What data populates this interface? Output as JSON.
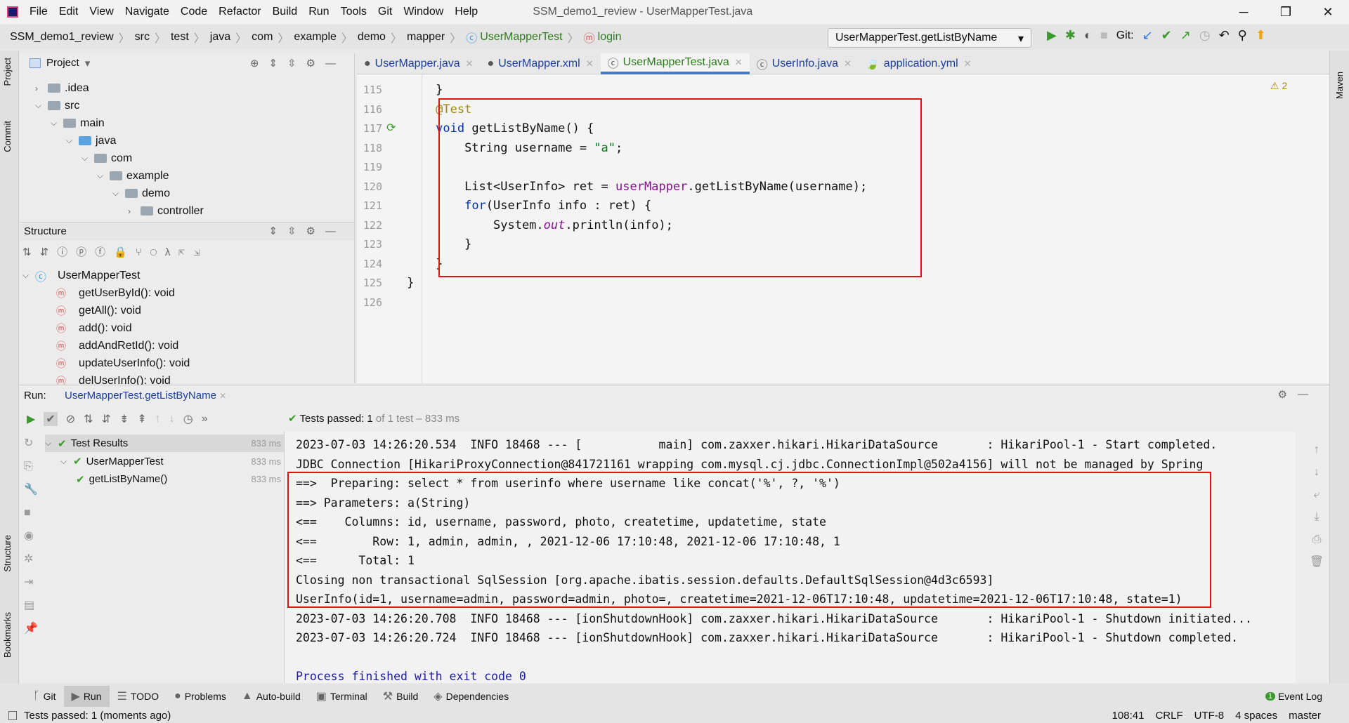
{
  "window": {
    "title": "SSM_demo1_review - UserMapperTest.java",
    "menu": [
      "File",
      "Edit",
      "View",
      "Navigate",
      "Code",
      "Refactor",
      "Build",
      "Run",
      "Tools",
      "Git",
      "Window",
      "Help"
    ],
    "controls": [
      "─",
      "❐",
      "✕"
    ]
  },
  "navbar": {
    "crumbs": [
      "SSM_demo1_review",
      "src",
      "test",
      "java",
      "com",
      "example",
      "demo",
      "mapper",
      "UserMapperTest",
      "login"
    ],
    "run_config": "UserMapperTest.getListByName",
    "git_label": "Git:"
  },
  "project": {
    "title": "Project",
    "tree": [
      {
        "label": ".idea",
        "depth": 1,
        "open": false
      },
      {
        "label": "src",
        "depth": 1,
        "open": true
      },
      {
        "label": "main",
        "depth": 2,
        "open": true
      },
      {
        "label": "java",
        "depth": 3,
        "open": true
      },
      {
        "label": "com",
        "depth": 4,
        "open": true
      },
      {
        "label": "example",
        "depth": 5,
        "open": true
      },
      {
        "label": "demo",
        "depth": 6,
        "open": true
      },
      {
        "label": "controller",
        "depth": 7,
        "open": false
      }
    ]
  },
  "structure": {
    "title": "Structure",
    "root": "UserMapperTest",
    "members": [
      "getUserById(): void",
      "getAll(): void",
      "add(): void",
      "addAndRetId(): void",
      "updateUserInfo(): void",
      "delUserInfo(): void"
    ]
  },
  "side_labels": {
    "left": [
      "Project",
      "Commit",
      "Structure",
      "Bookmarks"
    ],
    "right": [
      "Maven"
    ]
  },
  "editor": {
    "tabs": [
      {
        "label": "UserMapper.java",
        "active": false
      },
      {
        "label": "UserMapper.xml",
        "active": false
      },
      {
        "label": "UserMapperTest.java",
        "active": true
      },
      {
        "label": "UserInfo.java",
        "active": false
      },
      {
        "label": "application.yml",
        "active": false
      }
    ],
    "warnings": "⚠ 2",
    "lines": [
      {
        "n": "115",
        "tokens": [
          [
            "    }",
            ""
          ]
        ]
      },
      {
        "n": "116",
        "tokens": [
          [
            "    ",
            ""
          ],
          [
            "@Test",
            "ann"
          ]
        ]
      },
      {
        "n": "117",
        "tokens": [
          [
            "    ",
            ""
          ],
          [
            "void",
            "kw"
          ],
          [
            " getListByName() {",
            ""
          ]
        ]
      },
      {
        "n": "118",
        "tokens": [
          [
            "        String username = ",
            ""
          ],
          [
            "\"a\"",
            "str"
          ],
          [
            ";",
            ""
          ]
        ]
      },
      {
        "n": "119",
        "tokens": []
      },
      {
        "n": "120",
        "tokens": [
          [
            "        List<UserInfo> ret = ",
            ""
          ],
          [
            "userMapper",
            "fld"
          ],
          [
            ".getListByName(username);",
            ""
          ]
        ]
      },
      {
        "n": "121",
        "tokens": [
          [
            "        ",
            ""
          ],
          [
            "for",
            "kw"
          ],
          [
            "(UserInfo info : ret) {",
            ""
          ]
        ]
      },
      {
        "n": "122",
        "tokens": [
          [
            "            System.",
            ""
          ],
          [
            "out",
            "it"
          ],
          [
            ".println(info);",
            ""
          ]
        ]
      },
      {
        "n": "123",
        "tokens": [
          [
            "        }",
            ""
          ]
        ]
      },
      {
        "n": "124",
        "tokens": [
          [
            "    }",
            ""
          ]
        ]
      },
      {
        "n": "125",
        "tokens": [
          [
            "}",
            ""
          ]
        ]
      },
      {
        "n": "126",
        "tokens": []
      }
    ]
  },
  "run": {
    "label": "Run:",
    "tab": "UserMapperTest.getListByName",
    "status": "Tests passed:",
    "status_count": "1",
    "status_rest": "of 1 test – 833 ms",
    "tests": [
      {
        "label": "Test Results",
        "time": "833 ms",
        "depth": 0
      },
      {
        "label": "UserMapperTest",
        "time": "833 ms",
        "depth": 1
      },
      {
        "label": "getListByName()",
        "time": "833 ms",
        "depth": 2
      }
    ],
    "console": [
      "2023-07-03 14:26:20.534  INFO 18468 --- [           main] com.zaxxer.hikari.HikariDataSource       : HikariPool-1 - Start completed.",
      "JDBC Connection [HikariProxyConnection@841721161 wrapping com.mysql.cj.jdbc.ConnectionImpl@502a4156] will not be managed by Spring",
      "==>  Preparing: select * from userinfo where username like concat('%', ?, '%')",
      "==> Parameters: a(String)",
      "<==    Columns: id, username, password, photo, createtime, updatetime, state",
      "<==        Row: 1, admin, admin, , 2021-12-06 17:10:48, 2021-12-06 17:10:48, 1",
      "<==      Total: 1",
      "Closing non transactional SqlSession [org.apache.ibatis.session.defaults.DefaultSqlSession@4d3c6593]",
      "UserInfo(id=1, username=admin, password=admin, photo=, createtime=2021-12-06T17:10:48, updatetime=2021-12-06T17:10:48, state=1)",
      "2023-07-03 14:26:20.708  INFO 18468 --- [ionShutdownHook] com.zaxxer.hikari.HikariDataSource       : HikariPool-1 - Shutdown initiated...",
      "2023-07-03 14:26:20.724  INFO 18468 --- [ionShutdownHook] com.zaxxer.hikari.HikariDataSource       : HikariPool-1 - Shutdown completed.",
      "",
      "Process finished with exit code 0"
    ]
  },
  "bottom_tools": [
    {
      "label": "Git",
      "icon": "ᚴ"
    },
    {
      "label": "Run",
      "icon": "▶"
    },
    {
      "label": "TODO",
      "icon": "☰"
    },
    {
      "label": "Problems",
      "icon": "●"
    },
    {
      "label": "Auto-build",
      "icon": "▲"
    },
    {
      "label": "Terminal",
      "icon": "▣"
    },
    {
      "label": "Build",
      "icon": "⚒"
    },
    {
      "label": "Dependencies",
      "icon": "◈"
    }
  ],
  "event_log": {
    "label": "Event Log",
    "count": "1"
  },
  "statusbar": {
    "message": "Tests passed: 1 (moments ago)",
    "position": "108:41",
    "line_sep": "CRLF",
    "encoding": "UTF-8",
    "indent": "4 spaces",
    "branch": "master"
  },
  "colors": {
    "highlight_box": "#e01010",
    "active_tab_underline": "#4a7bc2",
    "pass_green": "#3c9a2c"
  }
}
